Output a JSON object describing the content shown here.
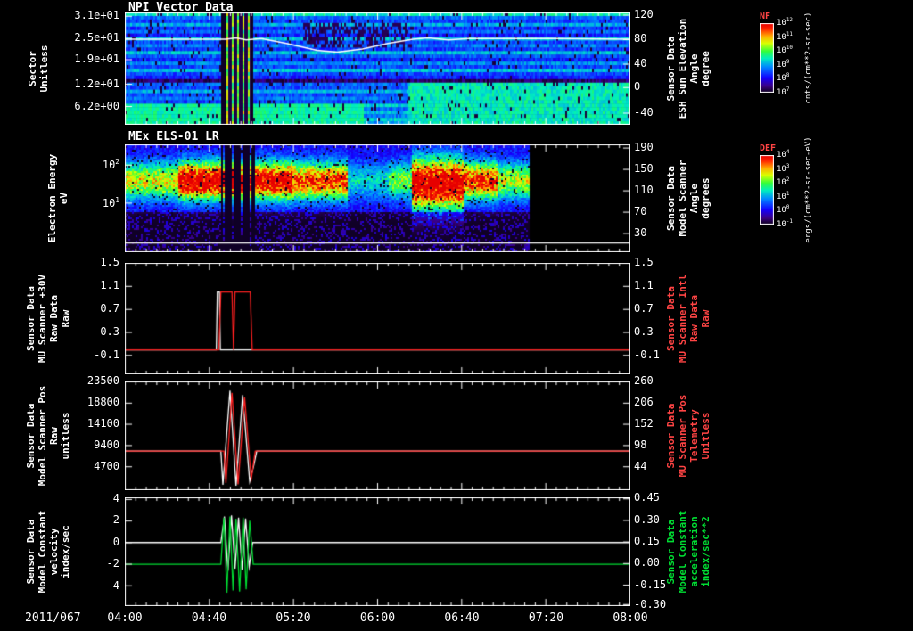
{
  "date_label": "2011/067",
  "time_axis": {
    "ticks": [
      "04:00",
      "04:40",
      "05:20",
      "06:00",
      "06:40",
      "07:20",
      "08:00"
    ]
  },
  "colors": {
    "background": "#000000",
    "frame": "#ffffff",
    "red": "#ff2020",
    "green": "#00dd33",
    "white": "#ffffff",
    "label_red": "#ff4444"
  },
  "colorbars": [
    {
      "name": "NF",
      "unit": "cnts/(cm**2-sr-sec)",
      "ticks": [
        "10^12",
        "10^11",
        "10^10",
        "10^9",
        "10^8",
        "10^7"
      ]
    },
    {
      "name": "DEF",
      "unit": "ergs/(cm**2-sr-sec-eV)",
      "ticks": [
        "10^4",
        "10^3",
        "10^2",
        "10^1",
        "10^0",
        "10^-1"
      ]
    }
  ],
  "chart_data": [
    {
      "id": "npi",
      "type": "heatmap",
      "title": "NPI Vector Data",
      "left_axis": {
        "title": [
          "Sector",
          "Unitless"
        ],
        "ticks": [
          {
            "label": "3.1e+01",
            "frac": 0.03
          },
          {
            "label": "2.5e+01",
            "frac": 0.23
          },
          {
            "label": "1.9e+01",
            "frac": 0.42
          },
          {
            "label": "1.2e+01",
            "frac": 0.64
          },
          {
            "label": "6.2e+00",
            "frac": 0.84
          }
        ]
      },
      "right_axis": {
        "title": [
          "Sensor Data",
          "ESH Sun Elevation",
          "Angle",
          "degree"
        ],
        "color": "#ffffff",
        "range": [
          122,
          -59
        ],
        "ticks": [
          {
            "label": "120",
            "frac": 0.02
          },
          {
            "label": "80",
            "frac": 0.24
          },
          {
            "label": "40",
            "frac": 0.46
          },
          {
            "label": "0",
            "frac": 0.67
          },
          {
            "label": "-40",
            "frac": 0.9
          }
        ]
      },
      "rows": 32,
      "row_levels": [
        0.5,
        0.34,
        0.3,
        0.42,
        0.28,
        0.34,
        0.25,
        0.44,
        0.3,
        0.36,
        0.28,
        0.44,
        0.32,
        0.26,
        0.38,
        0.3,
        0.44,
        0.3,
        0.26,
        0.08,
        0.34,
        0.3,
        0.42,
        0.3,
        0.36,
        0.3,
        0.46,
        0.34,
        0.44,
        0.36,
        0.46,
        0.4
      ],
      "features": {
        "gap1": [
          0.188,
          0.198
        ],
        "disturb": [
          0.198,
          0.247
        ],
        "gap2": [
          0.247,
          0.252
        ],
        "bottom_left_bright": {
          "rows": [
            26,
            31
          ],
          "x": [
            0,
            0.47
          ],
          "level": 0.52
        },
        "bottom_right_blob": {
          "rows": [
            20,
            31
          ],
          "x": [
            0.56,
            1
          ],
          "level": 0.5
        },
        "dark_patch": {
          "rows": [
            3,
            9
          ],
          "x": [
            0.35,
            0.57
          ]
        }
      },
      "overlay": {
        "color": "#ffffff",
        "points": [
          [
            0,
            79
          ],
          [
            0.2,
            79
          ],
          [
            0.22,
            81
          ],
          [
            0.24,
            78
          ],
          [
            0.27,
            80
          ],
          [
            0.32,
            72
          ],
          [
            0.38,
            61
          ],
          [
            0.42,
            58
          ],
          [
            0.47,
            63
          ],
          [
            0.52,
            72
          ],
          [
            0.57,
            79
          ],
          [
            0.6,
            81
          ],
          [
            0.64,
            78
          ],
          [
            0.68,
            80
          ],
          [
            0.75,
            80
          ],
          [
            0.85,
            80
          ],
          [
            1,
            79
          ]
        ]
      }
    },
    {
      "id": "els",
      "type": "heatmap",
      "title": "MEx ELS-01 LR",
      "left_axis": {
        "title": [
          "Electron Energy",
          "eV"
        ],
        "ticks": [
          {
            "label": "10^2",
            "frac": 0.19
          },
          {
            "label": "10^1",
            "frac": 0.545
          }
        ]
      },
      "right_axis": {
        "title": [
          "Sensor Data",
          "Model Scanner",
          "Angle",
          "degrees"
        ],
        "color": "#ffffff",
        "ticks": [
          {
            "label": "190",
            "frac": 0.03
          },
          {
            "label": "150",
            "frac": 0.23
          },
          {
            "label": "110",
            "frac": 0.43
          },
          {
            "label": "70",
            "frac": 0.63
          },
          {
            "label": "30",
            "frac": 0.83
          }
        ]
      },
      "data_end": 0.8,
      "band": {
        "center": 0.33,
        "sigma": 0.12
      },
      "segments": [
        {
          "x": [
            0,
            0.105
          ],
          "peak": 0.55
        },
        {
          "x": [
            0.105,
            0.19
          ],
          "peak": 0.95
        },
        {
          "x": [
            0.19,
            0.255
          ],
          "peak": 0.9,
          "gap": true
        },
        {
          "x": [
            0.255,
            0.33
          ],
          "peak": 0.92
        },
        {
          "x": [
            0.33,
            0.44
          ],
          "peak": 0.75
        },
        {
          "x": [
            0.44,
            0.52
          ],
          "peak": 0.28
        },
        {
          "x": [
            0.52,
            0.565
          ],
          "peak": 0.45
        },
        {
          "x": [
            0.565,
            0.67
          ],
          "peak": 0.97,
          "sigma": 0.16,
          "center": 0.36
        },
        {
          "x": [
            0.67,
            0.735
          ],
          "peak": 0.78
        },
        {
          "x": [
            0.735,
            0.8
          ],
          "peak": 0.5
        }
      ],
      "overlay": {
        "color": "#ffffff",
        "yfrac": 0.915
      }
    },
    {
      "id": "mu_scanner_30v",
      "type": "line",
      "ylim": [
        1.5,
        -0.42
      ],
      "left_axis": {
        "title": [
          "Sensor Data",
          "MU Scanner +30V",
          "Raw Data",
          "Raw"
        ],
        "ticks": [
          {
            "label": "1.5",
            "frac": 0
          },
          {
            "label": "1.1",
            "frac": 0.208
          },
          {
            "label": "0.7",
            "frac": 0.417
          },
          {
            "label": "0.3",
            "frac": 0.625
          },
          {
            "label": "-0.1",
            "frac": 0.833
          }
        ]
      },
      "right_axis": {
        "title": [
          "Sensor Data",
          "MU Scanner Intl",
          "Raw Data",
          "Raw"
        ],
        "color": "#ff4444",
        "ticks": [
          {
            "label": "1.5",
            "frac": 0
          },
          {
            "label": "1.1",
            "frac": 0.208
          },
          {
            "label": "0.7",
            "frac": 0.417
          },
          {
            "label": "0.3",
            "frac": 0.625
          },
          {
            "label": "-0.1",
            "frac": 0.833
          }
        ]
      },
      "series": [
        {
          "name": "white",
          "color": "#ffffff",
          "points": [
            [
              0,
              0
            ],
            [
              0.181,
              0
            ],
            [
              0.183,
              1
            ],
            [
              0.187,
              1
            ],
            [
              0.189,
              0
            ],
            [
              1,
              0
            ]
          ]
        },
        {
          "name": "red",
          "color": "#ff2020",
          "points": [
            [
              0,
              0
            ],
            [
              0.186,
              0
            ],
            [
              0.19,
              1
            ],
            [
              0.212,
              1
            ],
            [
              0.215,
              0
            ],
            [
              0.218,
              1
            ],
            [
              0.248,
              1
            ],
            [
              0.252,
              0
            ],
            [
              1,
              0
            ]
          ]
        }
      ]
    },
    {
      "id": "model_scanner_pos",
      "type": "line",
      "ylim": [
        23500,
        -390
      ],
      "left_axis": {
        "title": [
          "Sensor Data",
          "Model Scanner Pos",
          "Raw",
          "unitless"
        ],
        "ticks": [
          {
            "label": "23500",
            "frac": 0
          },
          {
            "label": "18800",
            "frac": 0.197
          },
          {
            "label": "14100",
            "frac": 0.393
          },
          {
            "label": "9400",
            "frac": 0.59
          },
          {
            "label": "4700",
            "frac": 0.787
          }
        ]
      },
      "right_axis": {
        "title": [
          "Sensor Data",
          "MU Scanner Pos",
          "Telemetry",
          "Unitless"
        ],
        "color": "#ff4444",
        "ticks": [
          {
            "label": "260",
            "frac": 0
          },
          {
            "label": "206",
            "frac": 0.197
          },
          {
            "label": "152",
            "frac": 0.393
          },
          {
            "label": "98",
            "frac": 0.59
          },
          {
            "label": "44",
            "frac": 0.787
          }
        ]
      },
      "series": [
        {
          "name": "white",
          "color": "#ffffff",
          "points": [
            [
              0,
              8200
            ],
            [
              0.19,
              8200
            ],
            [
              0.194,
              800
            ],
            [
              0.208,
              21500
            ],
            [
              0.22,
              600
            ],
            [
              0.233,
              20500
            ],
            [
              0.247,
              1500
            ],
            [
              0.255,
              5000
            ],
            [
              0.261,
              8200
            ],
            [
              1,
              8200
            ]
          ]
        },
        {
          "name": "red",
          "color": "#ff2020",
          "points": [
            [
              0,
              8200
            ],
            [
              0.196,
              8200
            ],
            [
              0.2,
              1200
            ],
            [
              0.212,
              21000
            ],
            [
              0.224,
              900
            ],
            [
              0.237,
              20000
            ],
            [
              0.25,
              2000
            ],
            [
              0.258,
              8200
            ],
            [
              1,
              8200
            ]
          ]
        }
      ]
    },
    {
      "id": "model_constant_velocity",
      "type": "line",
      "ylim": [
        4.16,
        -5.84
      ],
      "left_axis": {
        "title": [
          "Sensor Data",
          "Model Constant",
          "velocity",
          "index/sec"
        ],
        "ticks": [
          {
            "label": "4",
            "frac": 0.016
          },
          {
            "label": "2",
            "frac": 0.216
          },
          {
            "label": "0",
            "frac": 0.416
          },
          {
            "label": "-2",
            "frac": 0.616
          },
          {
            "label": "-4",
            "frac": 0.816
          }
        ]
      },
      "right_axis": {
        "title": [
          "Sensor Data",
          "Model Constant",
          "acceleration",
          "index/sec**2"
        ],
        "color": "#00dd33",
        "ticks": [
          {
            "label": "0.45",
            "frac": 0.01
          },
          {
            "label": "0.30",
            "frac": 0.21
          },
          {
            "label": "0.15",
            "frac": 0.41
          },
          {
            "label": "0.00",
            "frac": 0.61
          },
          {
            "label": "-0.15",
            "frac": 0.81
          },
          {
            "label": "-0.30",
            "frac": 0.99
          }
        ]
      },
      "series": [
        {
          "name": "white",
          "color": "#ffffff",
          "points": [
            [
              0,
              0
            ],
            [
              0.19,
              0
            ],
            [
              0.197,
              2.4
            ],
            [
              0.204,
              -2.6
            ],
            [
              0.211,
              2.5
            ],
            [
              0.218,
              -2.4
            ],
            [
              0.225,
              2.3
            ],
            [
              0.232,
              -2.5
            ],
            [
              0.239,
              2.2
            ],
            [
              0.246,
              -2.2
            ],
            [
              0.253,
              0
            ],
            [
              1,
              0
            ]
          ]
        },
        {
          "name": "green",
          "color": "#00dd33",
          "points": [
            [
              0,
              -2
            ],
            [
              0.19,
              -2
            ],
            [
              0.196,
              2.3
            ],
            [
              0.202,
              -4.6
            ],
            [
              0.208,
              2.4
            ],
            [
              0.214,
              -4.4
            ],
            [
              0.22,
              2.2
            ],
            [
              0.227,
              -4.5
            ],
            [
              0.234,
              2.3
            ],
            [
              0.24,
              -4.3
            ],
            [
              0.247,
              2
            ],
            [
              0.254,
              -2
            ],
            [
              1,
              -2
            ]
          ]
        }
      ]
    }
  ]
}
